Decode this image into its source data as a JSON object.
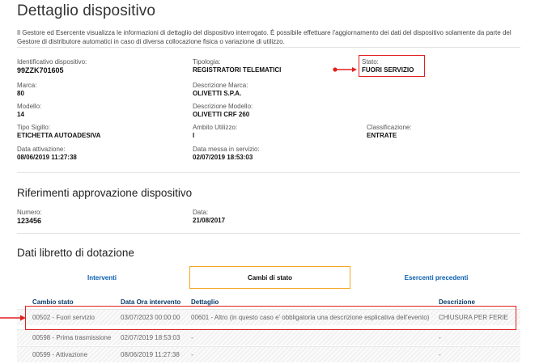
{
  "page": {
    "title": "Dettaglio dispositivo",
    "intro": "Il Gestore ed Esercente visualizza le informazioni di dettaglio del dispositivo interrogato. È possibile effettuare l'aggiornamento dei dati del dispositivo solamente da parte del Gestore di distributore automatici in caso di diversa collocazione fisica o variazione di utilizzo."
  },
  "device": {
    "id": {
      "label": "Identificativo dispositivo:",
      "value": "99ZZK701605"
    },
    "tipologia": {
      "label": "Tipologia:",
      "value": "REGISTRATORI TELEMATICI"
    },
    "stato": {
      "label": "Stato:",
      "value": "FUORI SERVIZIO"
    },
    "marca": {
      "label": "Marca:",
      "value": "80"
    },
    "descr_marca": {
      "label": "Descrizione Marca:",
      "value": "OLIVETTI S.P.A."
    },
    "modello": {
      "label": "Modello:",
      "value": "14"
    },
    "descr_modello": {
      "label": "Descrizione Modello:",
      "value": "OLIVETTI CRF 260"
    },
    "tipo_sigillo": {
      "label": "Tipo Sigillo:",
      "value": "ETICHETTA AUTOADESIVA"
    },
    "ambito": {
      "label": "Ambito Utilizzo:",
      "value": "I"
    },
    "classificazione": {
      "label": "Classificazione:",
      "value": "ENTRATE"
    },
    "data_attivazione": {
      "label": "Data attivazione:",
      "value": "08/06/2019 11:27:38"
    },
    "data_servizio": {
      "label": "Data messa in servizio:",
      "value": "02/07/2019 18:53:03"
    }
  },
  "approvazione": {
    "title": "Riferimenti approvazione dispositivo",
    "numero": {
      "label": "Numero:",
      "value": "123456"
    },
    "data": {
      "label": "Data:",
      "value": "21/08/2017"
    }
  },
  "libretto": {
    "title": "Dati libretto di dotazione",
    "tabs": [
      "Interventi",
      "Cambi di stato",
      "Esercenti precedenti"
    ],
    "active_tab": "Cambi di stato",
    "columns": [
      "Cambio stato",
      "Data Ora intervento",
      "Dettaglio",
      "Descrizione"
    ],
    "rows": [
      [
        "00502 - Fuori servizio",
        "03/07/2023 00:00:00",
        "00601 - Altro (in questo caso e' obbligatoria una descrizione esplicativa dell'evento)",
        "CHIUSURA PER FERIE"
      ],
      [
        "00598 - Prima trasmissione",
        "02/07/2019 18:53:03",
        "-",
        "-"
      ],
      [
        "00599 - Attivazione",
        "08/06/2019 11:27:38",
        "-",
        "-"
      ]
    ]
  },
  "colors": {
    "highlight": "#e02020",
    "tab_active_border": "#f5a623",
    "link": "#0b5fb0"
  }
}
